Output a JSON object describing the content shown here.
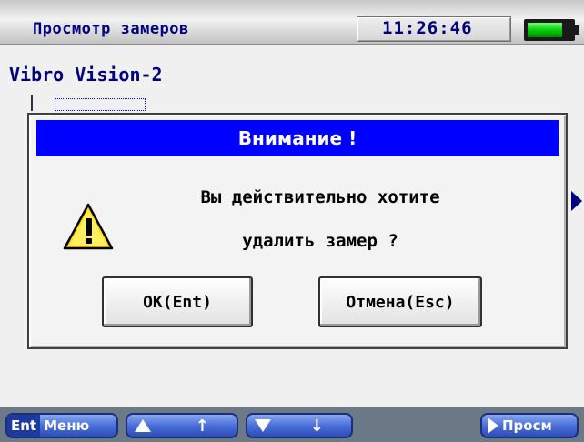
{
  "header": {
    "title": "Просмотр замеров",
    "time": "11:26:46",
    "battery_level": 0.74,
    "battery_color": "#00c800"
  },
  "main": {
    "device_name": "Vibro Vision-2"
  },
  "dialog": {
    "title": "Внимание !",
    "message_line1": "Вы действительно хотите",
    "message_line2": "удалить замер ?",
    "icon": "warning-icon",
    "ok_label": "OK(Ent)",
    "cancel_label": "Отмена(Esc)",
    "title_bg": "#0000ff"
  },
  "footer": {
    "menu_key": "Ent",
    "menu_label": "Меню",
    "up_arrow": "↑",
    "down_arrow": "↓",
    "view_label": "Просм",
    "button_color": "#4b6fd8"
  }
}
